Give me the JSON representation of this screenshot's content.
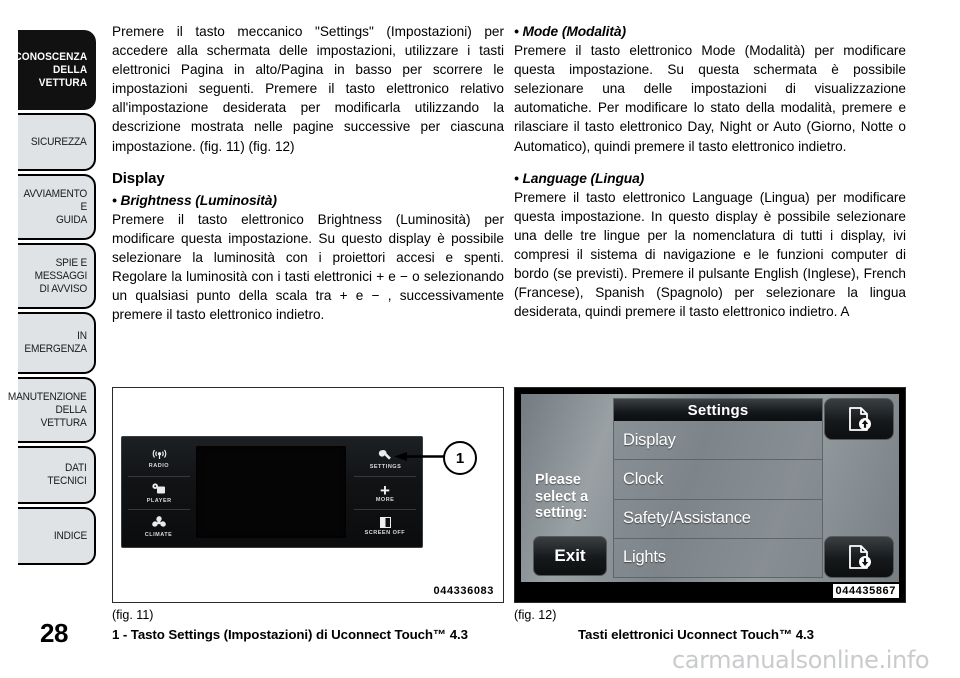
{
  "page": {
    "number": "28",
    "watermark": "carmanualsonline.info"
  },
  "sidebar": {
    "tabs": [
      {
        "label": "CONOSCENZA\nDELLA\nVETTURA",
        "active": true
      },
      {
        "label": "SICUREZZA",
        "active": false
      },
      {
        "label": "AVVIAMENTO\nE\nGUIDA",
        "active": false
      },
      {
        "label": "SPIE E\nMESSAGGI\nDI AVVISO",
        "active": false
      },
      {
        "label": "IN\nEMERGENZA",
        "active": false
      },
      {
        "label": "MANUTENZIONE\nDELLA\nVETTURA",
        "active": false
      },
      {
        "label": "DATI\nTECNICI",
        "active": false
      },
      {
        "label": "INDICE",
        "active": false
      }
    ]
  },
  "left_column": {
    "intro": "Premere il tasto meccanico \"Settings\" (Impostazioni) per accedere alla schermata delle impostazioni, utilizzare i tasti elettronici Pagina in alto/Pagina in basso per scorrere le impostazioni seguenti. Premere il tasto elettronico relativo all'impostazione desiderata per modificarla utilizzando la descrizione mostrata nelle pagine successive per ciascuna impostazione. (fig. 11) (fig. 12)",
    "heading": "Display",
    "brightness_head": "• Brightness (Luminosità)",
    "brightness_body": "Premere il tasto elettronico Brightness (Luminosità) per modificare questa impostazione. Su questo display è possibile selezionare la luminosità con i proiettori accesi e spenti. Regolare la luminosità con i tasti elettronici + e − o selezionando un qualsiasi punto della scala tra + e − , successivamente premere il tasto elettronico indietro."
  },
  "right_column": {
    "mode_head": "• Mode (Modalità)",
    "mode_body": "Premere il tasto elettronico Mode (Modalità) per modificare questa impostazione. Su questa schermata è possibile selezionare una delle impostazioni di visualizzazione automatiche. Per modificare lo stato della modalità, premere e rilasciare il tasto elettronico Day, Night or Auto (Giorno, Notte o Automatico), quindi premere il tasto elettronico indietro.",
    "language_head": "• Language (Lingua)",
    "language_body": "Premere il tasto elettronico Language (Lingua) per modificare questa impostazione. In questo display è possibile selezionare una delle tre lingue per la nomenclatura di tutti i display, ivi compresi il sistema di navigazione e le funzioni computer di bordo (se previsti). Premere il pulsante English (Inglese), French (Francese), Spanish (Spagnolo) per selezionare la lingua desiderata, quindi premere il tasto elettronico indietro. A"
  },
  "figure_11": {
    "caption": "(fig. 11)",
    "subcaption": "1 - Tasto Settings (Impostazioni) di Uconnect Touch™ 4.3",
    "code": "044336083",
    "callout": "1",
    "buttons_left": [
      {
        "label": "RADIO",
        "icon": "radio-waves-icon",
        "glyph": "((•))"
      },
      {
        "label": "PLAYER",
        "icon": "media-player-icon",
        "glyph": "♫"
      },
      {
        "label": "CLIMATE",
        "icon": "fan-icon",
        "glyph": "❁"
      }
    ],
    "buttons_right": [
      {
        "label": "SETTINGS",
        "icon": "wrench-icon",
        "glyph": "⚒"
      },
      {
        "label": "MORE",
        "icon": "plus-icon",
        "glyph": "+"
      },
      {
        "label": "SCREEN OFF",
        "icon": "screen-off-icon",
        "glyph": ""
      }
    ]
  },
  "figure_12": {
    "caption": "(fig. 12)",
    "subcaption": "Tasti elettronici Uconnect Touch™ 4.3",
    "code": "044435867",
    "screen": {
      "prompt": "Please\nselect a\nsetting:",
      "exit_label": "Exit",
      "list_title": "Settings",
      "list_items": [
        "Display",
        "Clock",
        "Safety/Assistance",
        "Lights"
      ],
      "page_up_icon": "page-up-icon",
      "page_down_icon": "page-down-icon"
    }
  }
}
